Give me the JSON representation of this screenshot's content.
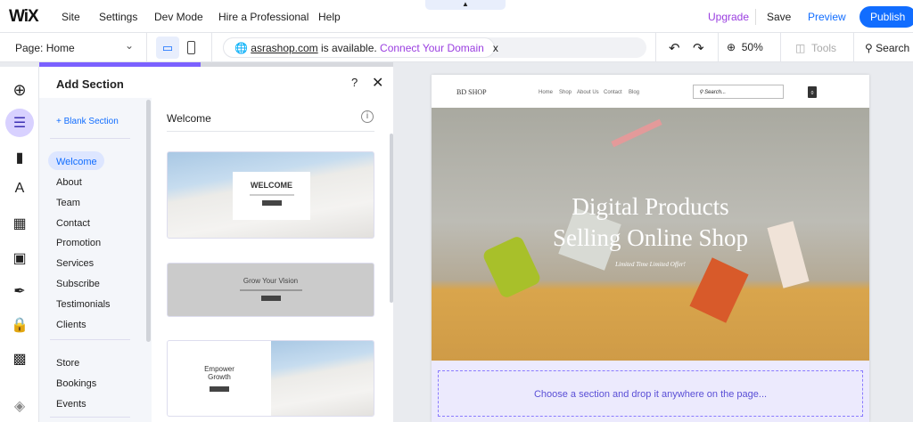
{
  "topbar": {
    "logo": "WiX",
    "menu": [
      "Site",
      "Settings",
      "Dev Mode",
      "Hire a Professional",
      "Help"
    ],
    "upgrade": "Upgrade",
    "save": "Save",
    "preview": "Preview",
    "publish": "Publish"
  },
  "toolbar": {
    "page": "Page: Home",
    "domain": "asrashop.com",
    "domain_text": " is available. ",
    "connect": "Connect Your Domain",
    "close": "x",
    "zoom": "50%",
    "tools": "Tools",
    "search": "Search"
  },
  "panel": {
    "title": "Add Section",
    "help": "?",
    "blank": "+ Blank Section",
    "nav_group1": [
      "Welcome",
      "About",
      "Team",
      "Contact",
      "Promotion",
      "Services",
      "Subscribe",
      "Testimonials",
      "Clients"
    ],
    "nav_group2": [
      "Store",
      "Bookings",
      "Events"
    ],
    "section_title": "Welcome",
    "cards": [
      {
        "title": "WELCOME"
      },
      {
        "title": "Grow Your Vision"
      },
      {
        "title": "Empower Growth"
      }
    ]
  },
  "site": {
    "brand": "BD SHOP",
    "nav": [
      "Home",
      "Shop",
      "About Us",
      "Contact",
      "Blog"
    ],
    "search_placeholder": "Search...",
    "cart_count": "0",
    "hero_title_1": "Digital Products",
    "hero_title_2": "Selling Online Shop",
    "hero_sub": "Limited Time Limited Offer!",
    "drop_text": "Choose a section and drop it anywhere on the page..."
  },
  "colors": {
    "accent": "#116dff",
    "upgrade": "#9a3ee0",
    "progress": "#7b61ff"
  }
}
